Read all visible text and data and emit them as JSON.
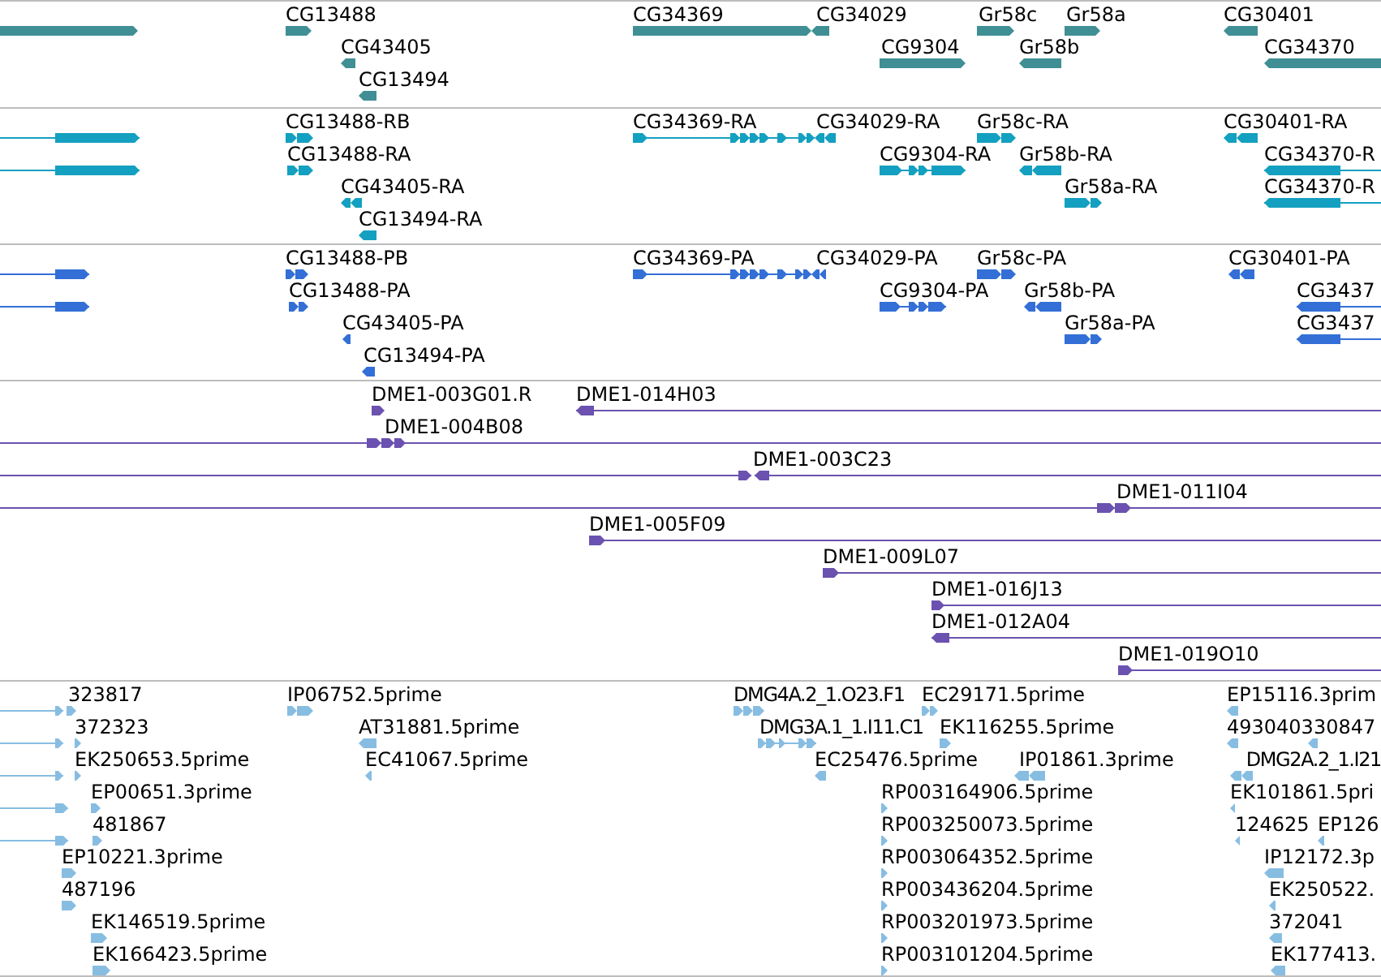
{
  "tracks": [
    {
      "color": "#3f8f94",
      "features": [
        {
          "reverse": false
        },
        {
          "label": "CG13488",
          "reverse": false
        },
        {
          "label": "CG34369",
          "reverse": false
        },
        {
          "label": "CG34029",
          "reverse": true
        },
        {
          "label": "Gr58c",
          "reverse": false
        },
        {
          "label": "Gr58a",
          "reverse": false
        },
        {
          "label": "CG30401",
          "reverse": true
        },
        {
          "label": "CG43405",
          "reverse": true
        },
        {
          "label": "CG9304",
          "reverse": false
        },
        {
          "label": "Gr58b",
          "reverse": true
        },
        {
          "label": "CG34370",
          "reverse": true
        },
        {
          "label": "CG13494",
          "reverse": true
        }
      ]
    },
    {
      "color": "#14a0c0",
      "features": [
        {
          "reverse": false
        },
        {
          "label": "CG13488-RB",
          "reverse": false
        },
        {
          "label": "CG34369-RA",
          "reverse": false
        },
        {
          "label": "CG34029-RA",
          "reverse": true
        },
        {
          "label": "Gr58c-RA",
          "reverse": false
        },
        {
          "label": "CG30401-RA",
          "reverse": true
        },
        {
          "reverse": false
        },
        {
          "label": "CG13488-RA",
          "reverse": false
        },
        {
          "label": "CG9304-RA",
          "reverse": false
        },
        {
          "label": "Gr58b-RA",
          "reverse": true
        },
        {
          "label": "CG34370-R",
          "reverse": true
        },
        {
          "label": "CG43405-RA",
          "reverse": true
        },
        {
          "label": "Gr58a-RA",
          "reverse": false
        },
        {
          "label": "CG34370-R",
          "reverse": true
        },
        {
          "label": "CG13494-RA",
          "reverse": true
        }
      ]
    },
    {
      "color": "#336fd6",
      "features": [
        {
          "reverse": false
        },
        {
          "label": "CG13488-PB",
          "reverse": false
        },
        {
          "label": "CG34369-PA",
          "reverse": false
        },
        {
          "label": "CG34029-PA",
          "reverse": true
        },
        {
          "label": "Gr58c-PA",
          "reverse": false
        },
        {
          "label": "CG30401-PA",
          "reverse": true
        },
        {
          "reverse": false
        },
        {
          "label": "CG13488-PA",
          "reverse": false
        },
        {
          "label": "CG9304-PA",
          "reverse": false
        },
        {
          "label": "Gr58b-PA",
          "reverse": true
        },
        {
          "label": "CG3437",
          "reverse": true
        },
        {
          "label": "CG43405-PA",
          "reverse": true
        },
        {
          "label": "Gr58a-PA",
          "reverse": false
        },
        {
          "label": "CG3437",
          "reverse": true
        },
        {
          "label": "CG13494-PA",
          "reverse": true
        }
      ]
    },
    {
      "color": "#6b52b0",
      "features": [
        {
          "label": "DME1-003G01.R",
          "reverse": false
        },
        {
          "label": "DME1-014H03",
          "reverse": true
        },
        {
          "label": "DME1-004B08",
          "reverse": false
        },
        {
          "reverse": false
        },
        {
          "label": "DME1-003C23",
          "reverse": true
        },
        {
          "label": "DME1-011I04",
          "reverse": false
        },
        {
          "label": "DME1-005F09",
          "reverse": false
        },
        {
          "label": "DME1-009L07",
          "reverse": false
        },
        {
          "label": "DME1-016J13",
          "reverse": false
        },
        {
          "label": "DME1-012A04",
          "reverse": true
        },
        {
          "label": "DME1-019O10",
          "reverse": false
        }
      ]
    },
    {
      "color": "#88bde2",
      "features": [
        {
          "reverse": false
        },
        {
          "label": "323817",
          "reverse": false
        },
        {
          "label": "IP06752.5prime",
          "reverse": false
        },
        {
          "label": "DMG4A.2_1.O23.F1",
          "reverse": false
        },
        {
          "label": "EC29171.5prime",
          "reverse": false
        },
        {
          "label": "EP15116.3prim",
          "reverse": true
        },
        {
          "reverse": false
        },
        {
          "label": "372323",
          "reverse": false
        },
        {
          "label": "AT31881.5prime",
          "reverse": true
        },
        {
          "label": "DMG3A.1_1.I11.C1",
          "reverse": false
        },
        {
          "label": "EK116255.5prime",
          "reverse": false
        },
        {
          "label": "493040330847",
          "reverse": true
        },
        {
          "reverse": true
        },
        {
          "reverse": false
        },
        {
          "label": "EK250653.5prime",
          "reverse": false
        },
        {
          "label": "EC41067.5prime",
          "reverse": true
        },
        {
          "label": "EC25476.5prime",
          "reverse": true
        },
        {
          "label": "IP01861.3prime",
          "reverse": true
        },
        {
          "label": "DMG2A.2_1.I21",
          "reverse": true
        },
        {
          "reverse": false
        },
        {
          "label": "EP00651.3prime",
          "reverse": false
        },
        {
          "label": "RP003164906.5prime",
          "reverse": false
        },
        {
          "label": "EK101861.5pri",
          "reverse": true
        },
        {
          "reverse": false
        },
        {
          "label": "481867",
          "reverse": false
        },
        {
          "label": "RP003250073.5prime",
          "reverse": false
        },
        {
          "label": "124625",
          "reverse": true
        },
        {
          "label": "EP126",
          "reverse": true
        },
        {
          "label": "EP10221.3prime",
          "reverse": false
        },
        {
          "label": "RP003064352.5prime",
          "reverse": false
        },
        {
          "label": "IP12172.3p",
          "reverse": true
        },
        {
          "label": "487196",
          "reverse": false
        },
        {
          "label": "RP003436204.5prime",
          "reverse": false
        },
        {
          "label": "EK250522.",
          "reverse": true
        },
        {
          "label": "EK146519.5prime",
          "reverse": false
        },
        {
          "label": "RP003201973.5prime",
          "reverse": false
        },
        {
          "label": "372041",
          "reverse": true
        },
        {
          "label": "EK166423.5prime",
          "reverse": false
        },
        {
          "label": "RP003101204.5prime",
          "reverse": false
        },
        {
          "label": "EK177413.",
          "reverse": true
        }
      ]
    }
  ]
}
